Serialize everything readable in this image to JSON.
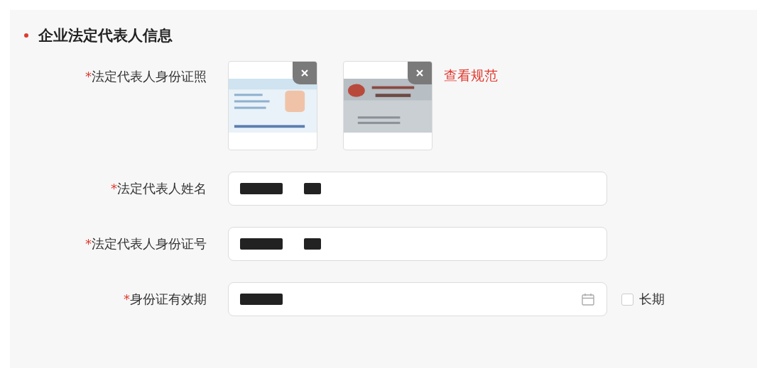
{
  "section": {
    "title": "企业法定代表人信息"
  },
  "fields": [
    {
      "kind": "upload",
      "label": "法定代表人身份证照",
      "mark": "*",
      "link": "查看规范"
    },
    {
      "kind": "text",
      "label": "法定代表人姓名",
      "mark": "*"
    },
    {
      "kind": "text",
      "label": "法定代表人身份证号",
      "mark": "*"
    },
    {
      "kind": "date",
      "label": "身份证有效期",
      "mark": "*",
      "checkbox": {
        "label": "长期",
        "checked": false
      }
    }
  ]
}
